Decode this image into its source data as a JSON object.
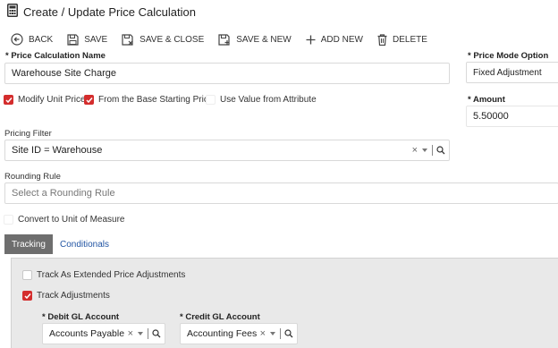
{
  "title": "Create / Update Price Calculation",
  "icons": {
    "title": "calculator-icon"
  },
  "toolbar": {
    "back": "BACK",
    "save": "SAVE",
    "save_close": "SAVE & CLOSE",
    "save_new": "SAVE & NEW",
    "add_new": "ADD NEW",
    "delete": "DELETE"
  },
  "form": {
    "name_label": "* Price Calculation Name",
    "name_value": "Warehouse Site Charge",
    "price_mode_label": "* Price Mode Option",
    "price_mode_value": "Fixed Adjustment",
    "modify_unit_price": "Modify Unit Price",
    "from_base_price": "From the Base Starting Price",
    "use_value_attr": "Use Value from Attribute",
    "amount_label": "* Amount",
    "amount_value": "5.50000",
    "pricing_filter_label": "Pricing Filter",
    "pricing_filter_value": "Site ID = Warehouse",
    "rounding_rule_label": "Rounding Rule",
    "rounding_rule_placeholder": "Select a Rounding Rule",
    "convert_uom": "Convert to Unit of Measure"
  },
  "checks": {
    "modify_unit_price": true,
    "from_base_price": true,
    "use_value_attr": false,
    "convert_uom": false,
    "track_extended": false,
    "track_adjustments": true
  },
  "tabs": [
    {
      "label": "Tracking"
    },
    {
      "label": "Conditionals"
    }
  ],
  "tracking": {
    "track_extended": "Track As Extended Price Adjustments",
    "track_adjustments": "Track Adjustments",
    "debit_label": "* Debit GL Account",
    "debit_value": "Accounts Payable",
    "credit_label": "* Credit GL Account",
    "credit_value": "Accounting Fees"
  },
  "colors": {
    "accent": "#d42d2d",
    "tab_active": "#6e6e6e",
    "link": "#2255a3"
  }
}
